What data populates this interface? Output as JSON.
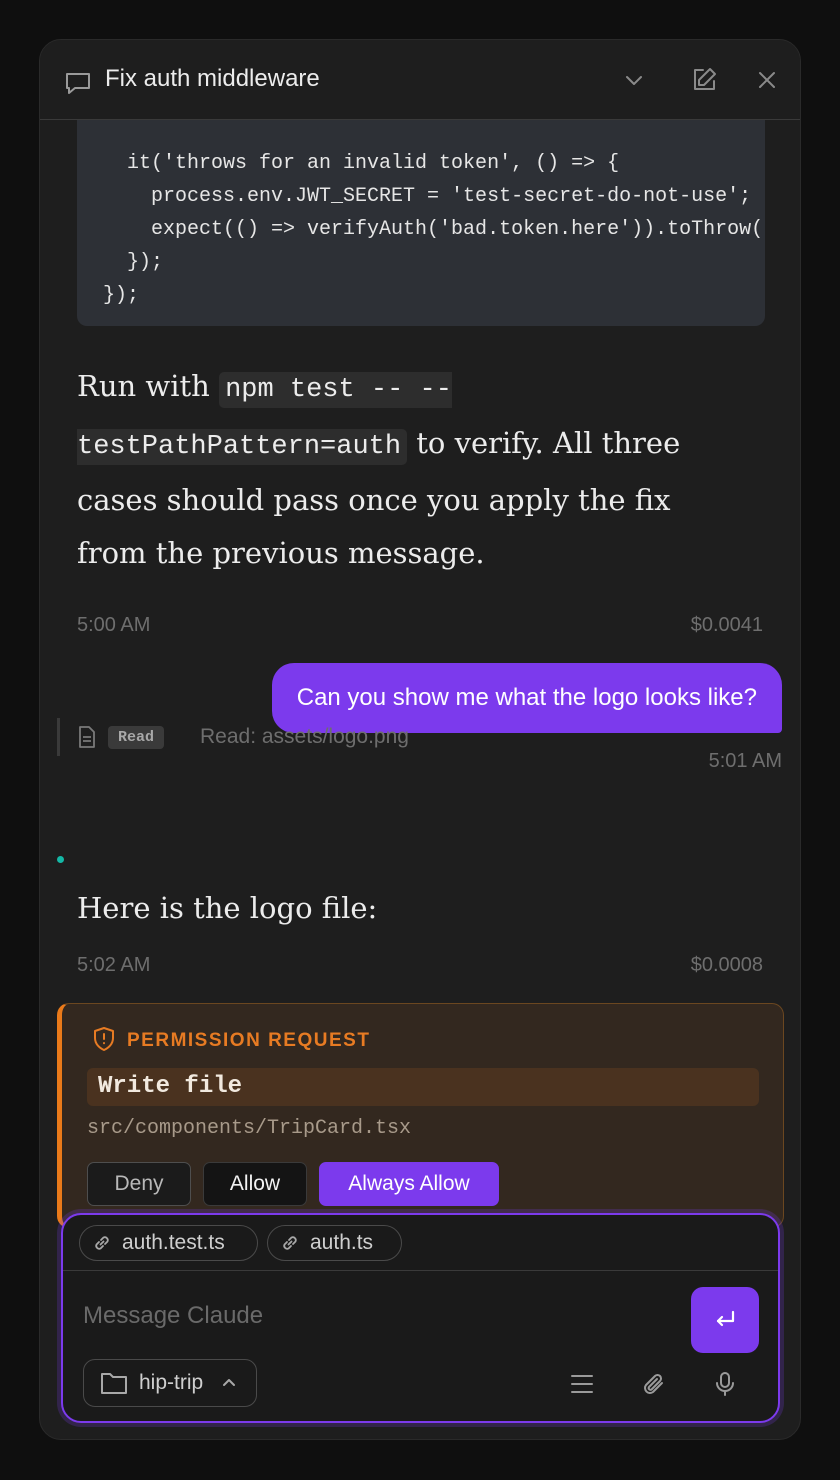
{
  "header": {
    "title": "Fix auth middleware",
    "icons": [
      "chat-bubble-icon",
      "chevron-down-icon",
      "edit-icon",
      "close-icon"
    ]
  },
  "messages": {
    "code_lines": [
      "  it('throws for an invalid token', () => {",
      "    process.env.JWT_SECRET = 'test-secret-do-not-use';",
      "    expect(() => verifyAuth('bad.token.here')).toThrow();",
      "  });",
      "});"
    ],
    "assistant1": {
      "text_before": "Run with ",
      "code": "npm test -- --testPathPattern=auth",
      "text_after": " to verify. All three cases should pass once you apply the fix from the previous message.",
      "time": "5:00 AM",
      "cost": "$0.0041"
    },
    "user1": {
      "text": "Can you show me what the logo looks like?",
      "time": "5:01 AM"
    },
    "tool": {
      "badge": "Read",
      "text": "Read: assets/logo.png"
    },
    "assistant2": {
      "text": "Here is the logo file:",
      "time": "5:02 AM",
      "cost": "$0.0008"
    }
  },
  "permission": {
    "title": "PERMISSION REQUEST",
    "action": "Write file",
    "path": "src/components/TripCard.tsx",
    "deny_label": "Deny",
    "allow_label": "Allow",
    "always_allow_label": "Always Allow"
  },
  "composer": {
    "chips": [
      "auth.test.ts",
      "auth.ts"
    ],
    "placeholder": "Message Claude",
    "folder": "hip-trip"
  },
  "colors": {
    "accent": "#7c3aed",
    "warning": "#ea7a1a",
    "status_dot": "#14b8a6"
  }
}
